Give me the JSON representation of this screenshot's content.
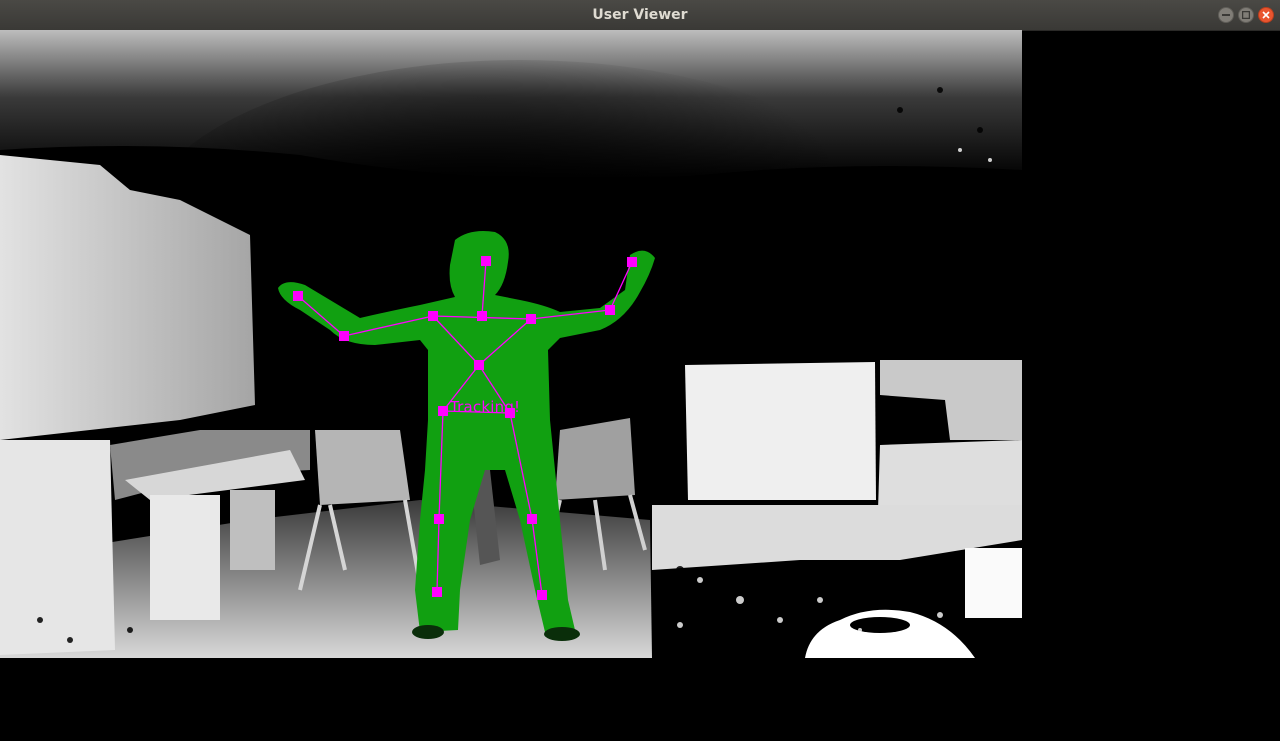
{
  "window": {
    "title": "User Viewer",
    "buttons": [
      "minimize",
      "maximize",
      "close"
    ]
  },
  "viewer": {
    "status_text": "Tracking!",
    "colors": {
      "user_mask": "#11a011",
      "skeleton": "#ff00ff",
      "background": "#000000"
    },
    "joint_names": [
      "head",
      "neck",
      "left-shoulder",
      "right-shoulder",
      "left-elbow",
      "right-elbow",
      "left-hand",
      "right-hand",
      "torso",
      "left-hip",
      "right-hip",
      "left-knee",
      "right-knee",
      "left-foot",
      "right-foot"
    ]
  },
  "icons": {
    "minimize": "minimize-icon",
    "maximize": "maximize-icon",
    "close": "close-icon"
  }
}
